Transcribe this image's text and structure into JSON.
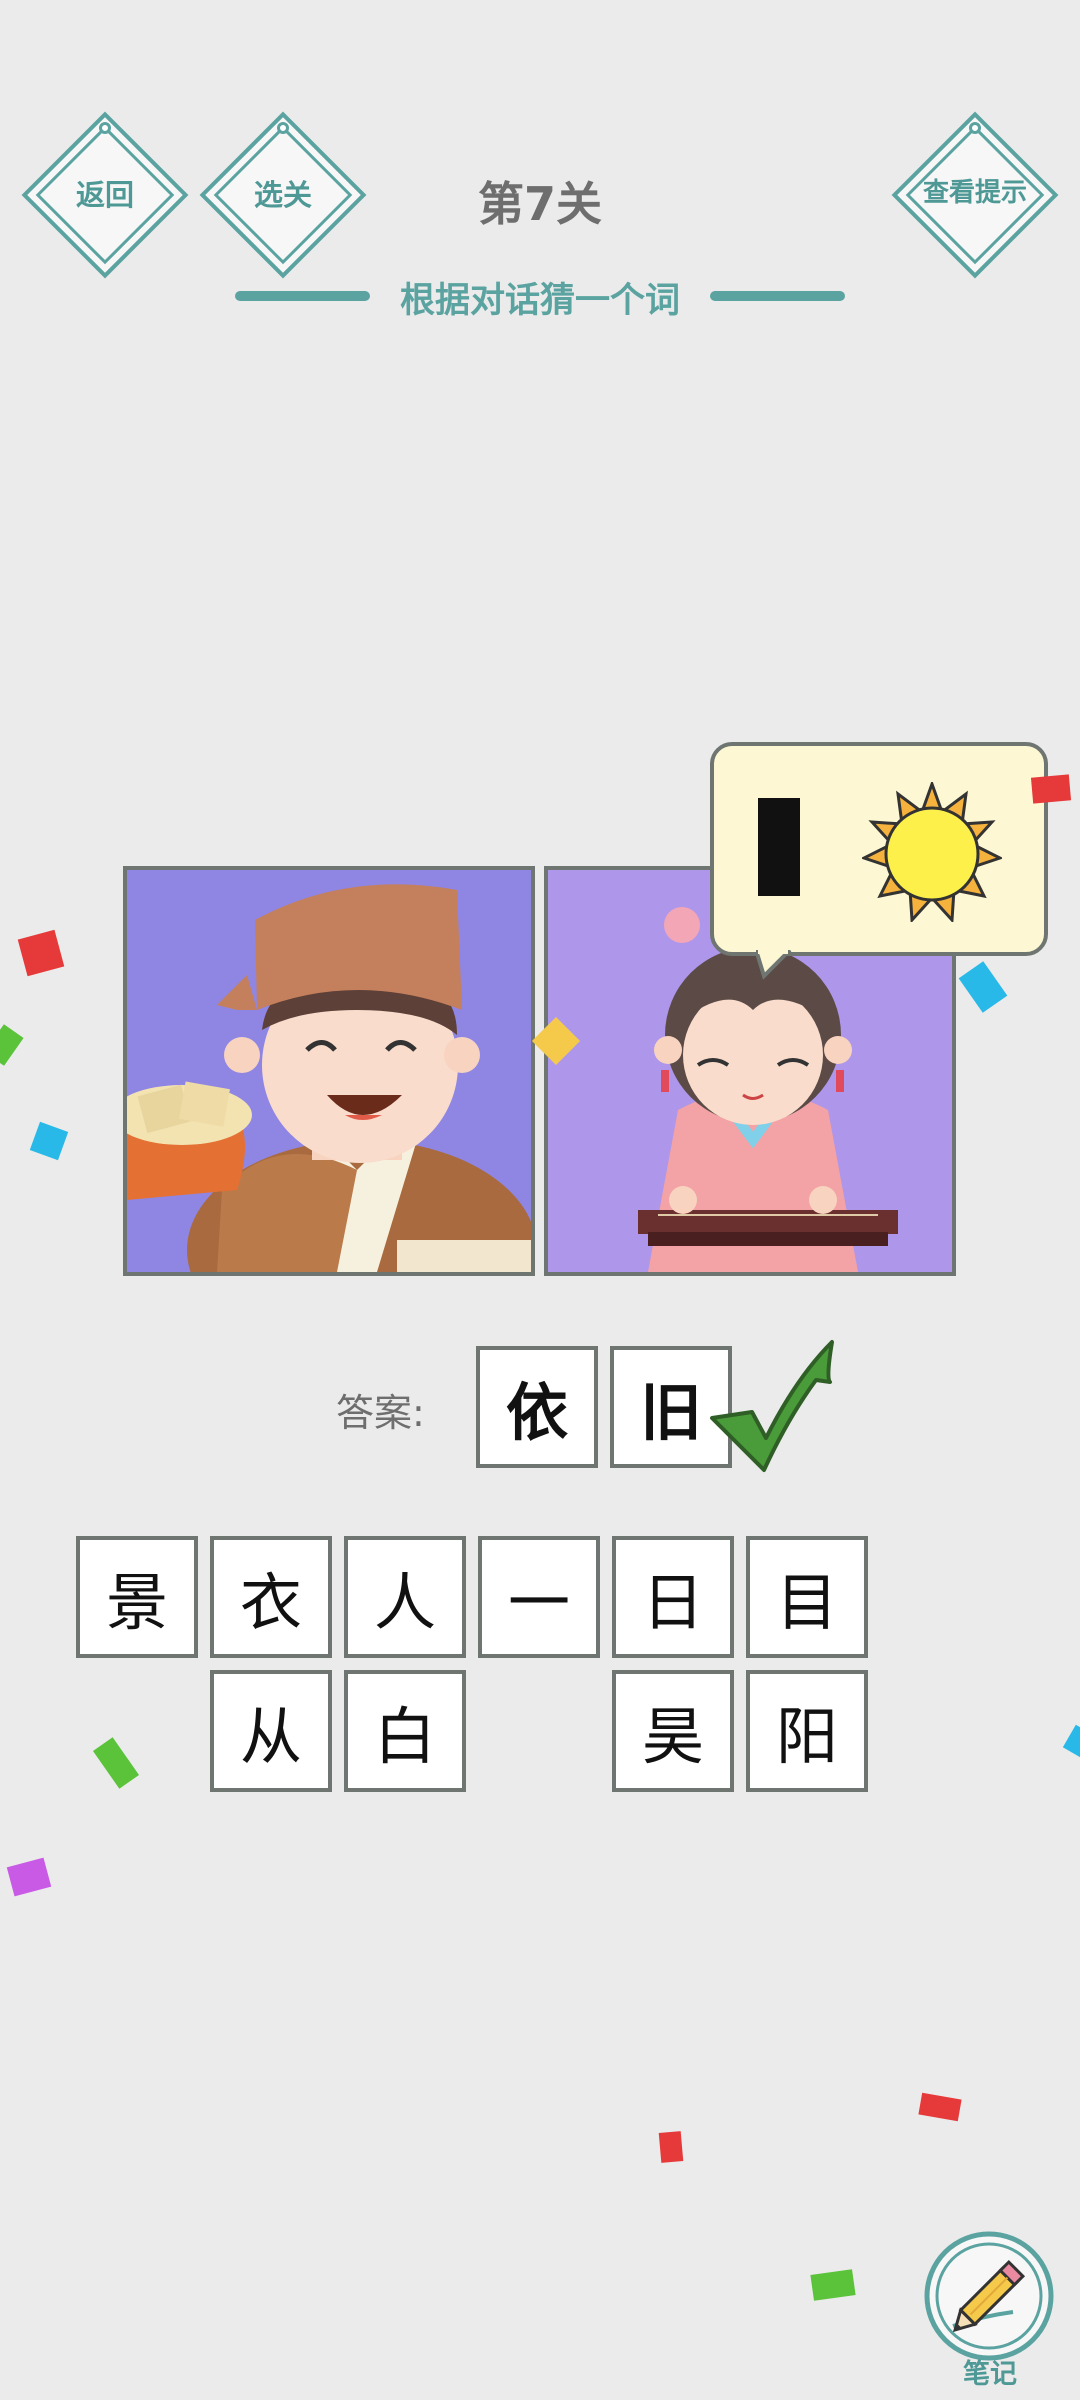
{
  "header": {
    "back_label": "返回",
    "select_level_label": "选关",
    "hint_label": "查看提示",
    "level_title": "第7关",
    "subtitle": "根据对话猜一个词"
  },
  "puzzle": {
    "answer_label": "答案:",
    "answer_chars": [
      "依",
      "旧"
    ],
    "choices_row1": [
      "景",
      "衣",
      "人",
      "一",
      "日",
      "目"
    ],
    "choices_row2": [
      "从",
      "白",
      "",
      "昊",
      "阳"
    ]
  },
  "footer": {
    "note_label": "笔记"
  },
  "colors": {
    "accent": "#5aa3a0",
    "background": "#ebebeb",
    "tile_border": "#6f7672",
    "check_green": "#4a9b3a"
  },
  "icons": {
    "check": "check-mark-icon",
    "note": "pencil-icon",
    "bubble_symbols": [
      "vertical-bar-icon",
      "sun-icon"
    ]
  }
}
